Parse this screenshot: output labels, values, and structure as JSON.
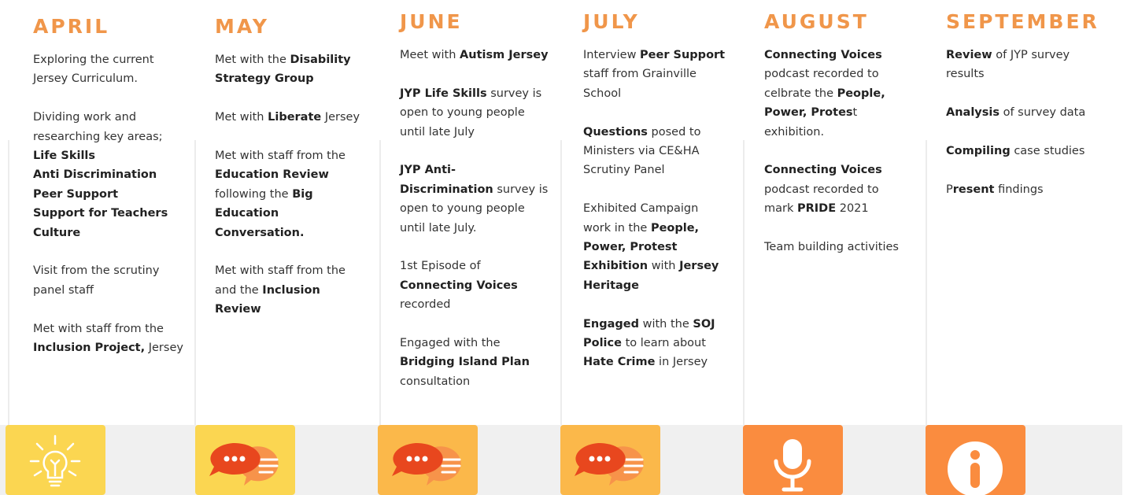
{
  "colors": {
    "month_orange": "#f0964a",
    "tile_yellow": "#fbd651",
    "tile_light_orange": "#fbb84a",
    "tile_orange": "#fa8c3f",
    "bubble_red": "#e8471e",
    "bubble_orange": "#f7934a",
    "bottom_bar": "#f0f0f0"
  },
  "columns": [
    {
      "month": "APRIL",
      "blocks": [
        [
          [
            {
              "t": "Exploring the current"
            }
          ],
          [
            {
              "t": "Jersey Curriculum."
            }
          ]
        ],
        [
          [
            {
              "t": "Dividing work and"
            }
          ],
          [
            {
              "t": "researching key areas;"
            }
          ],
          [
            {
              "t": "Life Skills",
              "b": true
            }
          ],
          [
            {
              "t": "Anti Discrimination",
              "b": true
            }
          ],
          [
            {
              "t": "Peer Support",
              "b": true
            }
          ],
          [
            {
              "t": "Support for Teachers",
              "b": true
            }
          ],
          [
            {
              "t": "Culture",
              "b": true
            }
          ]
        ],
        [
          [
            {
              "t": "Visit from the scrutiny"
            }
          ],
          [
            {
              "t": "panel staff"
            }
          ]
        ],
        [
          [
            {
              "t": "Met with staff from the"
            }
          ],
          [
            {
              "t": "Inclusion Project,",
              "b": true
            },
            {
              "t": " Jersey"
            }
          ]
        ]
      ]
    },
    {
      "month": "MAY",
      "blocks": [
        [
          [
            {
              "t": "Met with the "
            },
            {
              "t": "Disability",
              "b": true
            }
          ],
          [
            {
              "t": "Strategy Group",
              "b": true
            }
          ]
        ],
        [
          [
            {
              "t": "Met with "
            },
            {
              "t": "Liberate",
              "b": true
            },
            {
              "t": " Jersey"
            }
          ]
        ],
        [
          [
            {
              "t": "Met with staff from the"
            }
          ],
          [
            {
              "t": "Education Review",
              "b": true
            }
          ],
          [
            {
              "t": "following the "
            },
            {
              "t": "Big",
              "b": true
            }
          ],
          [
            {
              "t": "Education",
              "b": true
            }
          ],
          [
            {
              "t": "Conversation.",
              "b": true
            }
          ]
        ],
        [
          [
            {
              "t": "Met with staff from the"
            }
          ],
          [
            {
              "t": "and the "
            },
            {
              "t": "Inclusion",
              "b": true
            }
          ],
          [
            {
              "t": "Review",
              "b": true
            }
          ]
        ]
      ]
    },
    {
      "month": "JUNE",
      "blocks": [
        [
          [
            {
              "t": "Meet with "
            },
            {
              "t": "Autism Jersey",
              "b": true
            }
          ]
        ],
        [
          [
            {
              "t": "JYP Life Skills",
              "b": true
            },
            {
              "t": " survey is"
            }
          ],
          [
            {
              "t": "open to young people"
            }
          ],
          [
            {
              "t": "until late July"
            }
          ]
        ],
        [
          [
            {
              "t": "JYP Anti-",
              "b": true
            }
          ],
          [
            {
              "t": "Discrimination",
              "b": true
            },
            {
              "t": " survey is"
            }
          ],
          [
            {
              "t": "open to young people"
            }
          ],
          [
            {
              "t": "until late July."
            }
          ]
        ],
        [
          [
            {
              "t": "1st Episode of"
            }
          ],
          [
            {
              "t": "Connecting Voices",
              "b": true
            }
          ],
          [
            {
              "t": "recorded"
            }
          ]
        ],
        [
          [
            {
              "t": "Engaged with the"
            }
          ],
          [
            {
              "t": "Bridging Island Plan",
              "b": true
            }
          ],
          [
            {
              "t": "consultation"
            }
          ]
        ]
      ]
    },
    {
      "month": "JULY",
      "blocks": [
        [
          [
            {
              "t": "Interview "
            },
            {
              "t": "Peer Support",
              "b": true
            }
          ],
          [
            {
              "t": "staff from  Grainville"
            }
          ],
          [
            {
              "t": "School"
            }
          ]
        ],
        [
          [
            {
              "t": "Questions",
              "b": true
            },
            {
              "t": " posed to"
            }
          ],
          [
            {
              "t": "Ministers via CE&HA"
            }
          ],
          [
            {
              "t": "Scrutiny Panel"
            }
          ]
        ],
        [
          [
            {
              "t": "Exhibited Campaign"
            }
          ],
          [
            {
              "t": "work in the "
            },
            {
              "t": "People,",
              "b": true
            }
          ],
          [
            {
              "t": "Power, Protest",
              "b": true
            }
          ],
          [
            {
              "t": "Exhibition",
              "b": true
            },
            {
              "t": " with "
            },
            {
              "t": "Jersey",
              "b": true
            }
          ],
          [
            {
              "t": "Heritage",
              "b": true
            }
          ]
        ],
        [
          [
            {
              "t": "Engaged",
              "b": true
            },
            {
              "t": " with the "
            },
            {
              "t": "SOJ",
              "b": true
            }
          ],
          [
            {
              "t": "Police",
              "b": true
            },
            {
              "t": " to learn about"
            }
          ],
          [
            {
              "t": "Hate Crime",
              "b": true
            },
            {
              "t": " in Jersey"
            }
          ]
        ]
      ]
    },
    {
      "month": "AUGUST",
      "blocks": [
        [
          [
            {
              "t": "Connecting Voices",
              "b": true
            }
          ],
          [
            {
              "t": "podcast recorded to"
            }
          ],
          [
            {
              "t": "celbrate the "
            },
            {
              "t": "People,",
              "b": true
            }
          ],
          [
            {
              "t": "Power, Protes",
              "b": true
            },
            {
              "t": "t"
            }
          ],
          [
            {
              "t": "exhibition."
            }
          ]
        ],
        [
          [
            {
              "t": "Connecting Voices",
              "b": true
            }
          ],
          [
            {
              "t": "podcast recorded to"
            }
          ],
          [
            {
              "t": "mark "
            },
            {
              "t": "PRIDE",
              "b": true
            },
            {
              "t": " 2021"
            }
          ]
        ],
        [
          [
            {
              "t": "Team building activities"
            }
          ]
        ]
      ]
    },
    {
      "month": "SEPTEMBER",
      "blocks": [
        [
          [
            {
              "t": "Review",
              "b": true
            },
            {
              "t": " of JYP survey"
            }
          ],
          [
            {
              "t": "results"
            }
          ]
        ],
        [
          [
            {
              "t": "Analysis",
              "b": true
            },
            {
              "t": " of survey data"
            }
          ]
        ],
        [
          [
            {
              "t": "Compiling",
              "b": true
            },
            {
              "t": " case studies"
            }
          ]
        ],
        [
          [
            {
              "t": "P"
            },
            {
              "t": "resent",
              "b": true
            },
            {
              "t": " findings"
            }
          ]
        ]
      ]
    }
  ],
  "icons": [
    {
      "name": "lightbulb-icon",
      "tile": "tile_yellow"
    },
    {
      "name": "chat-bubbles-icon",
      "tile": "tile_yellow"
    },
    {
      "name": "chat-bubbles-icon",
      "tile": "tile_light_orange"
    },
    {
      "name": "chat-bubbles-icon",
      "tile": "tile_light_orange"
    },
    {
      "name": "microphone-icon",
      "tile": "tile_orange"
    },
    {
      "name": "info-icon",
      "tile": "tile_orange"
    }
  ]
}
